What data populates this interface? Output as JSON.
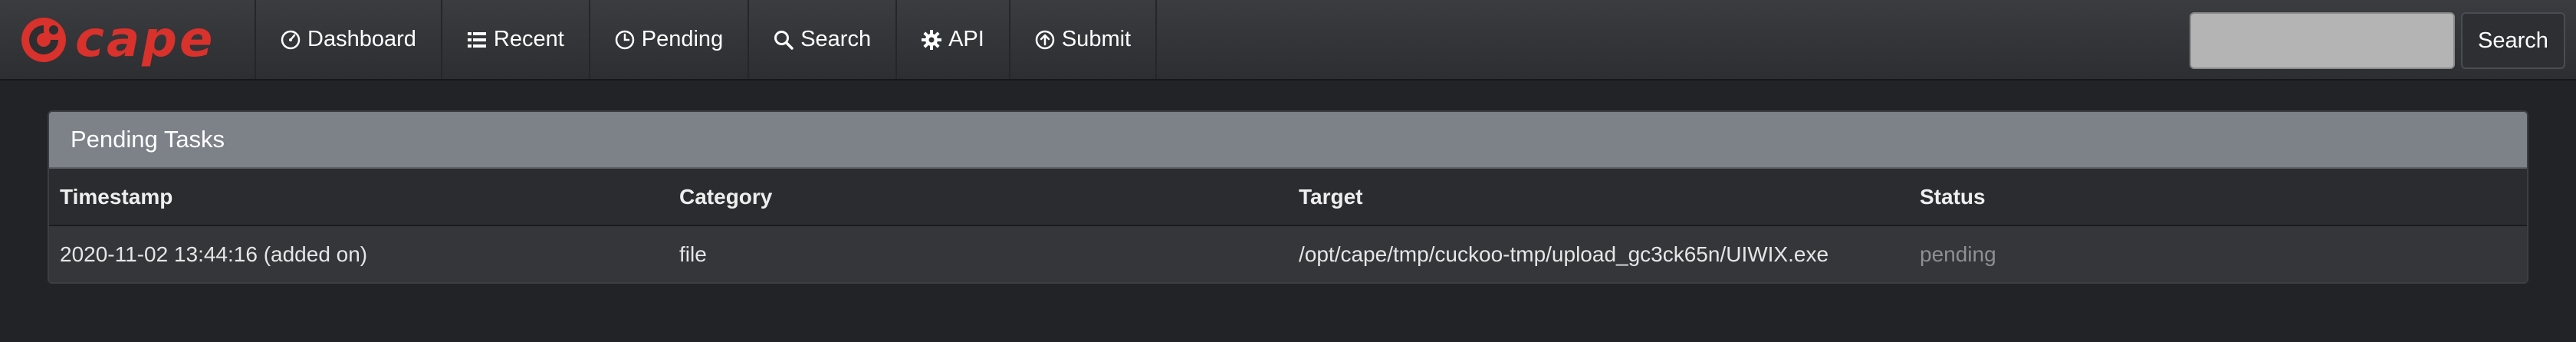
{
  "brand": {
    "name": "cape",
    "logo_icon": "cape-logo-icon",
    "accent": "#d9312b"
  },
  "nav": [
    {
      "id": "dashboard",
      "label": "Dashboard",
      "icon": "speedometer-icon"
    },
    {
      "id": "recent",
      "label": "Recent",
      "icon": "list-icon"
    },
    {
      "id": "pending",
      "label": "Pending",
      "icon": "clock-icon"
    },
    {
      "id": "search",
      "label": "Search",
      "icon": "search-icon"
    },
    {
      "id": "api",
      "label": "API",
      "icon": "gear-icon"
    },
    {
      "id": "submit",
      "label": "Submit",
      "icon": "upload-icon"
    }
  ],
  "search": {
    "value": "",
    "placeholder": "",
    "button_label": "Search"
  },
  "panel": {
    "title": "Pending Tasks",
    "columns": [
      "Timestamp",
      "Category",
      "Target",
      "Status"
    ],
    "rows": [
      {
        "timestamp": "2020-11-02 13:44:16 (added on)",
        "category": "file",
        "target": "/opt/cape/tmp/cuckoo-tmp/upload_gc3ck65n/UIWIX.exe",
        "status": "pending"
      }
    ]
  }
}
